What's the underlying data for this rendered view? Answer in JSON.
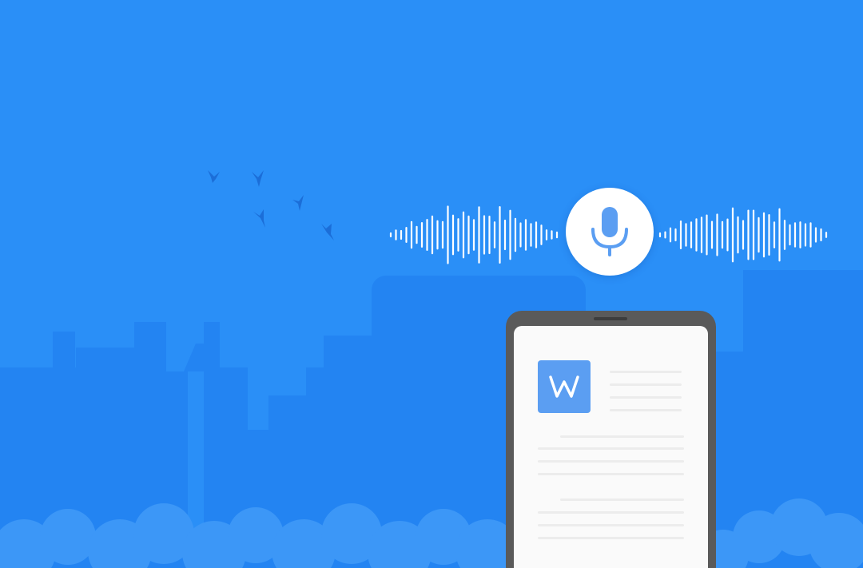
{
  "scene": {
    "background_color": "#2a8ff7",
    "skyline_color": "#2384f2",
    "cloud_color": "#3c97f7",
    "bird_color": "#1b6ed8",
    "wave_color": "#ffffff",
    "bird_count": 5
  },
  "mic_button": {
    "icon": "microphone-icon",
    "color": "#5b9ef2"
  },
  "phone": {
    "body_color": "#5a5a5a",
    "screen_color": "#fafafa",
    "app_icon": {
      "name": "word-document-icon",
      "glyph": "W",
      "color": "#5b9ef2"
    }
  }
}
